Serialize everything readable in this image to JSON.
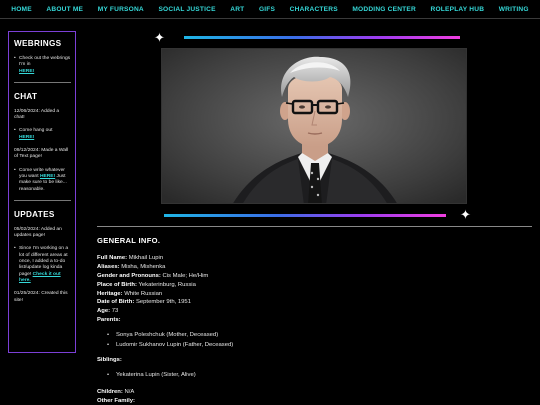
{
  "nav": [
    {
      "label": "HOME"
    },
    {
      "label": "ABOUT ME"
    },
    {
      "label": "MY FURSONA"
    },
    {
      "label": "SOCIAL JUSTICE"
    },
    {
      "label": "ART"
    },
    {
      "label": "GIFS"
    },
    {
      "label": "CHARACTERS"
    },
    {
      "label": "MODDING CENTER"
    },
    {
      "label": "ROLEPLAY HUB"
    },
    {
      "label": "WRITING"
    }
  ],
  "sidebar": {
    "webrings": {
      "heading": "WEBRINGS",
      "item_text": "Check out the webrings I'm in",
      "item_link": "HERE!"
    },
    "chat": {
      "heading": "CHAT",
      "date1": "12/06/2024: Added a chat!",
      "item1_text": "Come hang out",
      "item1_link": "HERE!",
      "date2": "09/12/2024: Made a Wall of Text page!",
      "item2_text": "Come write whatever you want",
      "item2_link": "HERE!",
      "item2_after": "Just make sure to be like... reasonable."
    },
    "updates": {
      "heading": "UPDATES",
      "date1": "05/02/2024: Added an updates page!",
      "item1_text": "Since I'm working on a lot of different areas at once, I added a to-do list/update log kinda page!",
      "item1_link": "Check it out here.",
      "date2": "01/25/2024: Created this site!"
    }
  },
  "main": {
    "section_title": "GENERAL INFO.",
    "fields": {
      "full_name_label": "Full Name:",
      "full_name": "Mikhail Lupin",
      "aliases_label": "Aliases:",
      "aliases": "Misha, Mishenka",
      "gender_label": "Gender and Pronouns:",
      "gender": "Cis Male; He/Him",
      "pob_label": "Place of Birth:",
      "pob": "Yekaterinburg, Russia",
      "heritage_label": "Heritage:",
      "heritage": "White Russian",
      "dob_label": "Date of Birth:",
      "dob": "September 9th, 1951",
      "age_label": "Age:",
      "age": "73",
      "parents_label": "Parents:",
      "parents": [
        "Sonya Poleshchuk (Mother, Deceased)",
        "Ludomir Sukhanov Lupin (Father, Deceased)"
      ],
      "siblings_label": "Siblings:",
      "siblings": [
        "Yekaterina Lupin (Sister, Alive)"
      ],
      "children_label": "Children:",
      "children": "N/A",
      "other_family_label": "Other Family:"
    }
  },
  "colors": {
    "nav_text": "#35d8d8",
    "sidebar_border": "#7b3fd6",
    "bar_start": "#1fb6e6",
    "bar_end": "#f03ee0"
  }
}
